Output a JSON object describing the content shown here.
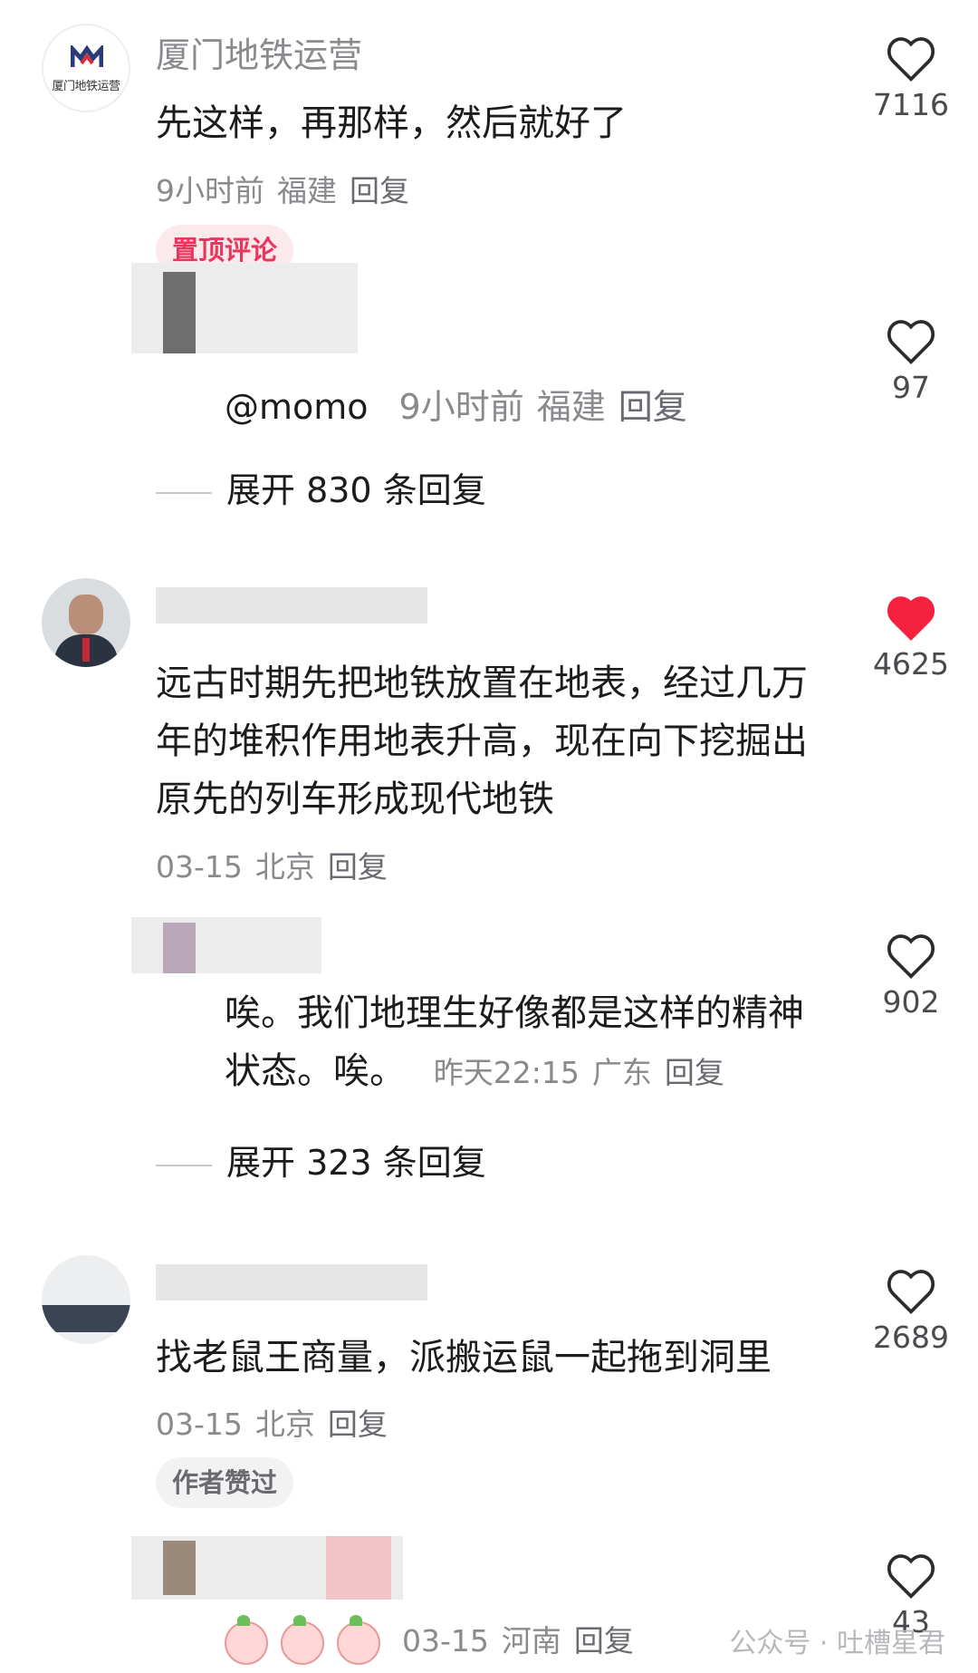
{
  "comments": [
    {
      "author": "厦门地铁运营",
      "avatar_text": "厦门地铁运营",
      "text": "先这样，再那样，然后就好了",
      "time": "9小时前",
      "location": "福建",
      "reply_label": "回复",
      "badge": "置顶评论",
      "likes": "7116",
      "liked": false,
      "reply": {
        "text": "@momo",
        "time": "9小时前",
        "location": "福建",
        "reply_label": "回复",
        "likes": "97"
      },
      "expand_label": "展开 830 条回复"
    },
    {
      "text": "远古时期先把地铁放置在地表，经过几万年的堆积作用地表升高，现在向下挖掘出原先的列车形成现代地铁",
      "time": "03-15",
      "location": "北京",
      "reply_label": "回复",
      "likes": "4625",
      "liked": true,
      "reply": {
        "text": "唉。我们地理生好像都是这样的精神状态。唉。",
        "time": "昨天22:15",
        "location": "广东",
        "reply_label": "回复",
        "likes": "902"
      },
      "expand_label": "展开 323 条回复"
    },
    {
      "text": "找老鼠王商量，派搬运鼠一起拖到洞里",
      "time": "03-15",
      "location": "北京",
      "reply_label": "回复",
      "badge": "作者赞过",
      "likes": "2689",
      "liked": false
    },
    {
      "time": "03-15",
      "location": "河南",
      "reply_label": "回复",
      "likes": "43",
      "liked": false,
      "emoji_name": "crying-emoji"
    }
  ],
  "watermark": "公众号 · 吐槽星君",
  "colors": {
    "liked_red": "#f5213f",
    "badge_pin": "#e8375c",
    "meta_gray": "#8a8a8e"
  }
}
